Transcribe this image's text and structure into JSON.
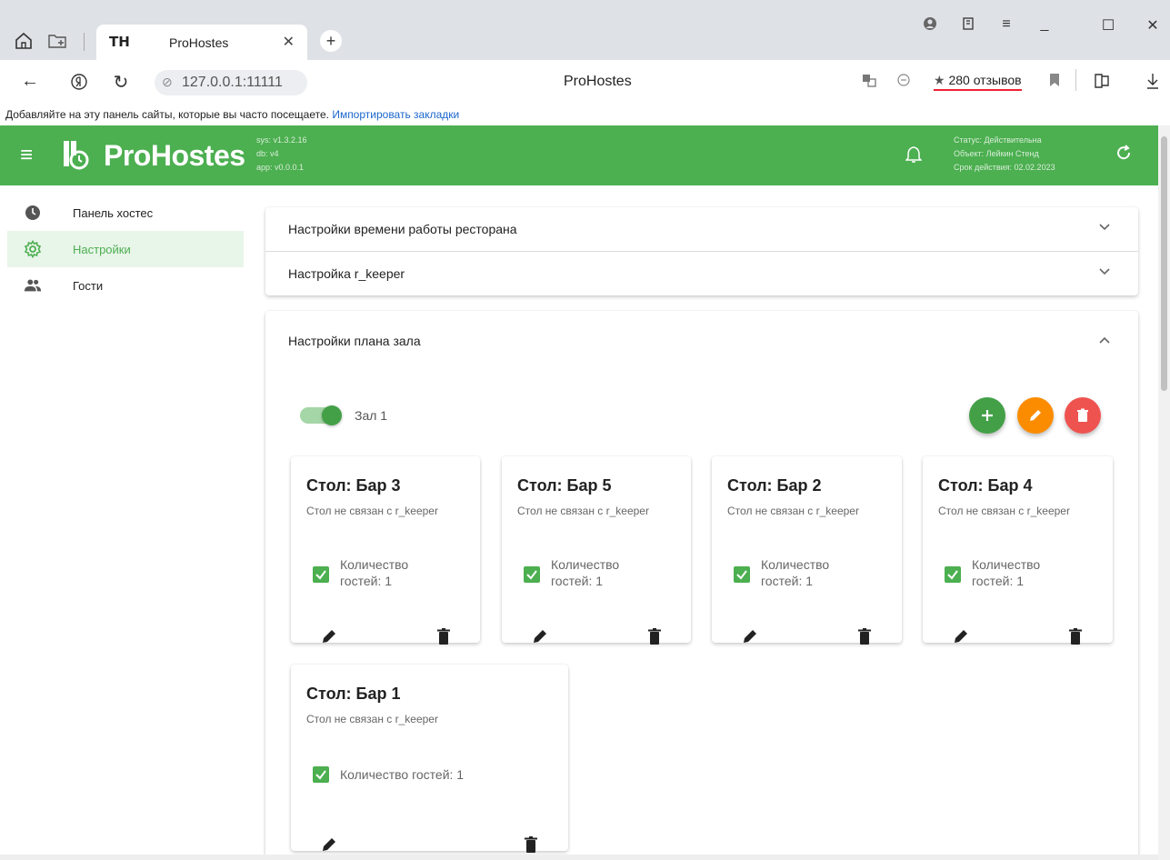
{
  "browser": {
    "tab_title": "ProHostes",
    "tab_favicon": "TH",
    "url": "127.0.0.1:11111",
    "page_title": "ProHostes",
    "reviews": "280 отзывов",
    "reviews_star": "★",
    "bookmarks_hint": "Добавляйте на эту панель сайты, которые вы часто посещаете.",
    "bookmarks_import": "Импортировать закладки"
  },
  "app": {
    "brand": "ProHostes",
    "version_sys": "sys: v1.3.2.16",
    "version_db": "db: v4",
    "version_app": "app: v0.0.0.1",
    "status": "Статус: Действительна",
    "object": "Объект: Лейкин Стенд",
    "expiry": "Срок действия: 02.02.2023",
    "accent": "#4caf50"
  },
  "sidebar": {
    "items": [
      {
        "label": "Панель хостес",
        "icon": "clock-icon"
      },
      {
        "label": "Настройки",
        "icon": "gear-icon",
        "active": true
      },
      {
        "label": "Гости",
        "icon": "people-icon"
      }
    ]
  },
  "settings": {
    "work_hours": "Настройки времени работы ресторана",
    "rkeeper": "Настройка r_keeper",
    "floor_plan": "Настройки плана зала"
  },
  "hall": {
    "label": "Зал 1",
    "enabled": true
  },
  "tables": [
    {
      "title": "Стол: Бар 3",
      "subtitle": "Стол не связан с r_keeper",
      "guests_l1": "Количество",
      "guests_l2": "гостей: 1",
      "checked": true
    },
    {
      "title": "Стол: Бар 5",
      "subtitle": "Стол не связан с r_keeper",
      "guests_l1": "Количество",
      "guests_l2": "гостей: 1",
      "checked": true
    },
    {
      "title": "Стол: Бар 2",
      "subtitle": "Стол не связан с r_keeper",
      "guests_l1": "Количество",
      "guests_l2": "гостей: 1",
      "checked": true
    },
    {
      "title": "Стол: Бар 4",
      "subtitle": "Стол не связан с r_keeper",
      "guests_l1": "Количество",
      "guests_l2": "гостей: 1",
      "checked": true
    },
    {
      "title": "Стол: Бар 1",
      "subtitle": "Стол не связан с r_keeper",
      "guests_l1": "Количество гостей: 1",
      "guests_l2": "",
      "checked": true
    }
  ]
}
